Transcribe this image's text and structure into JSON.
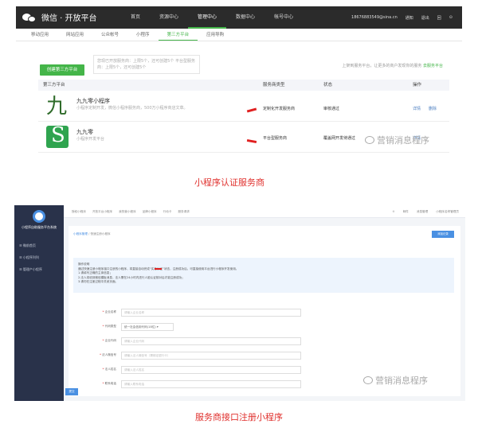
{
  "shot1": {
    "brand": "微信 · 开放平台",
    "topnav": [
      "首页",
      "资源中心",
      "管理中心",
      "数据中心",
      "帐号中心"
    ],
    "topnav_active": 2,
    "email": "18676883549@sina.cn",
    "topright": [
      "通知",
      "退出",
      "回",
      "⊙"
    ],
    "subnav": [
      "移动应用",
      "网站应用",
      "公众帐号",
      "小程序",
      "第三方平台",
      "应用导购"
    ],
    "subnav_active": 4,
    "create_button": "创建第三方平台",
    "quota_text": "您现已开放服务商：上限5个，还可创建5个 平台型服务商：上限5个，还可创建5个",
    "right_note": "上架到服务平台，让更多的商户发现你的服务",
    "right_note_link": "去服务平台",
    "table_headers": {
      "name": "第三方平台",
      "type": "服务商类型",
      "status": "状态",
      "ops": "操作"
    },
    "rows": [
      {
        "icon_char": "九",
        "name": "九九零小程序",
        "desc": "小程序定制开发，微信小程序服务商，500万小程序商店文章。",
        "type": "定制化开发服务商",
        "status": "审核通过",
        "op1": "详情",
        "op2": "删除"
      },
      {
        "name": "九九零",
        "desc": "小程序开发平台",
        "type": "平台型服务商",
        "status": "覆盖网开发待通过",
        "op1": "详情",
        "op2": ""
      }
    ],
    "watermark": "营销消息程序",
    "caption": "小程序认证服务商"
  },
  "shot2": {
    "side_title": "小程序自助服务平台系统",
    "side_items": [
      "微前首页",
      "小程序列列",
      "管理产小程序"
    ],
    "tabs": [
      "授权小程序",
      "开放平台小程序",
      "我的营小程序",
      "品牌小程序",
      "行动卡",
      "服务请求"
    ],
    "top_right": [
      "⊙",
      "邮件",
      "消息管理",
      "小程序名称管理员"
    ],
    "crumb_a": "小程序管理",
    "crumb_sep": "/",
    "crumb_b": "快速注册小程序",
    "top_button": "添加记录",
    "info_title": "操作说明",
    "info_lines": [
      "通过快速注册小程序接口注册的小程序，将直接自动完成“实名认证”状态，注册成功后，可直接使用平台进行小程序开发使用。",
      "1.请填写正确的主体信息；",
      "2.法人将收到微信模板消息，法人需在24小时内进行人脸认证核对后才能注册成功；",
      "3.请勿在注册过程中关闭页面。"
    ],
    "form": [
      {
        "label": "企业名称",
        "placeholder": "请输入企业名称",
        "type": "input"
      },
      {
        "label": "代码类型",
        "value": "统一社会信用代码(18位)",
        "type": "select"
      },
      {
        "label": "企业代码",
        "placeholder": "请输入企业代码",
        "type": "input"
      },
      {
        "label": "法人微信号",
        "placeholder": "请输入法人微信号（需绑定银行卡）",
        "type": "input"
      },
      {
        "label": "法人姓名",
        "placeholder": "请输入法人姓名",
        "type": "input"
      },
      {
        "label": "联系电话",
        "placeholder": "请输入联系电话",
        "type": "input"
      }
    ],
    "submit": "提交",
    "watermark": "营销消息程序",
    "caption": "服务商接口注册小程序"
  }
}
